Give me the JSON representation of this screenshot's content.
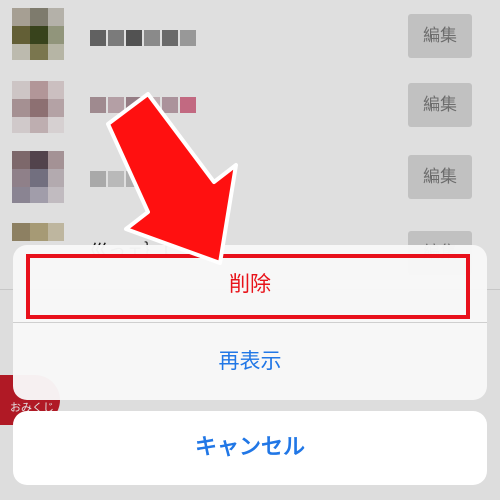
{
  "list": {
    "edit_label": "編集",
    "partial_text": "巛っェ｝【",
    "badge_text": "おみくじ"
  },
  "action_sheet": {
    "delete_label": "削除",
    "reshow_label": "再表示",
    "cancel_label": "キャンセル"
  },
  "colors": {
    "destructive": "#e8131a",
    "action": "#2177e6",
    "highlight": "#e8101b",
    "arrow": "#ff1010"
  },
  "icons": {
    "annotation_arrow": "arrow-down-right-icon"
  }
}
